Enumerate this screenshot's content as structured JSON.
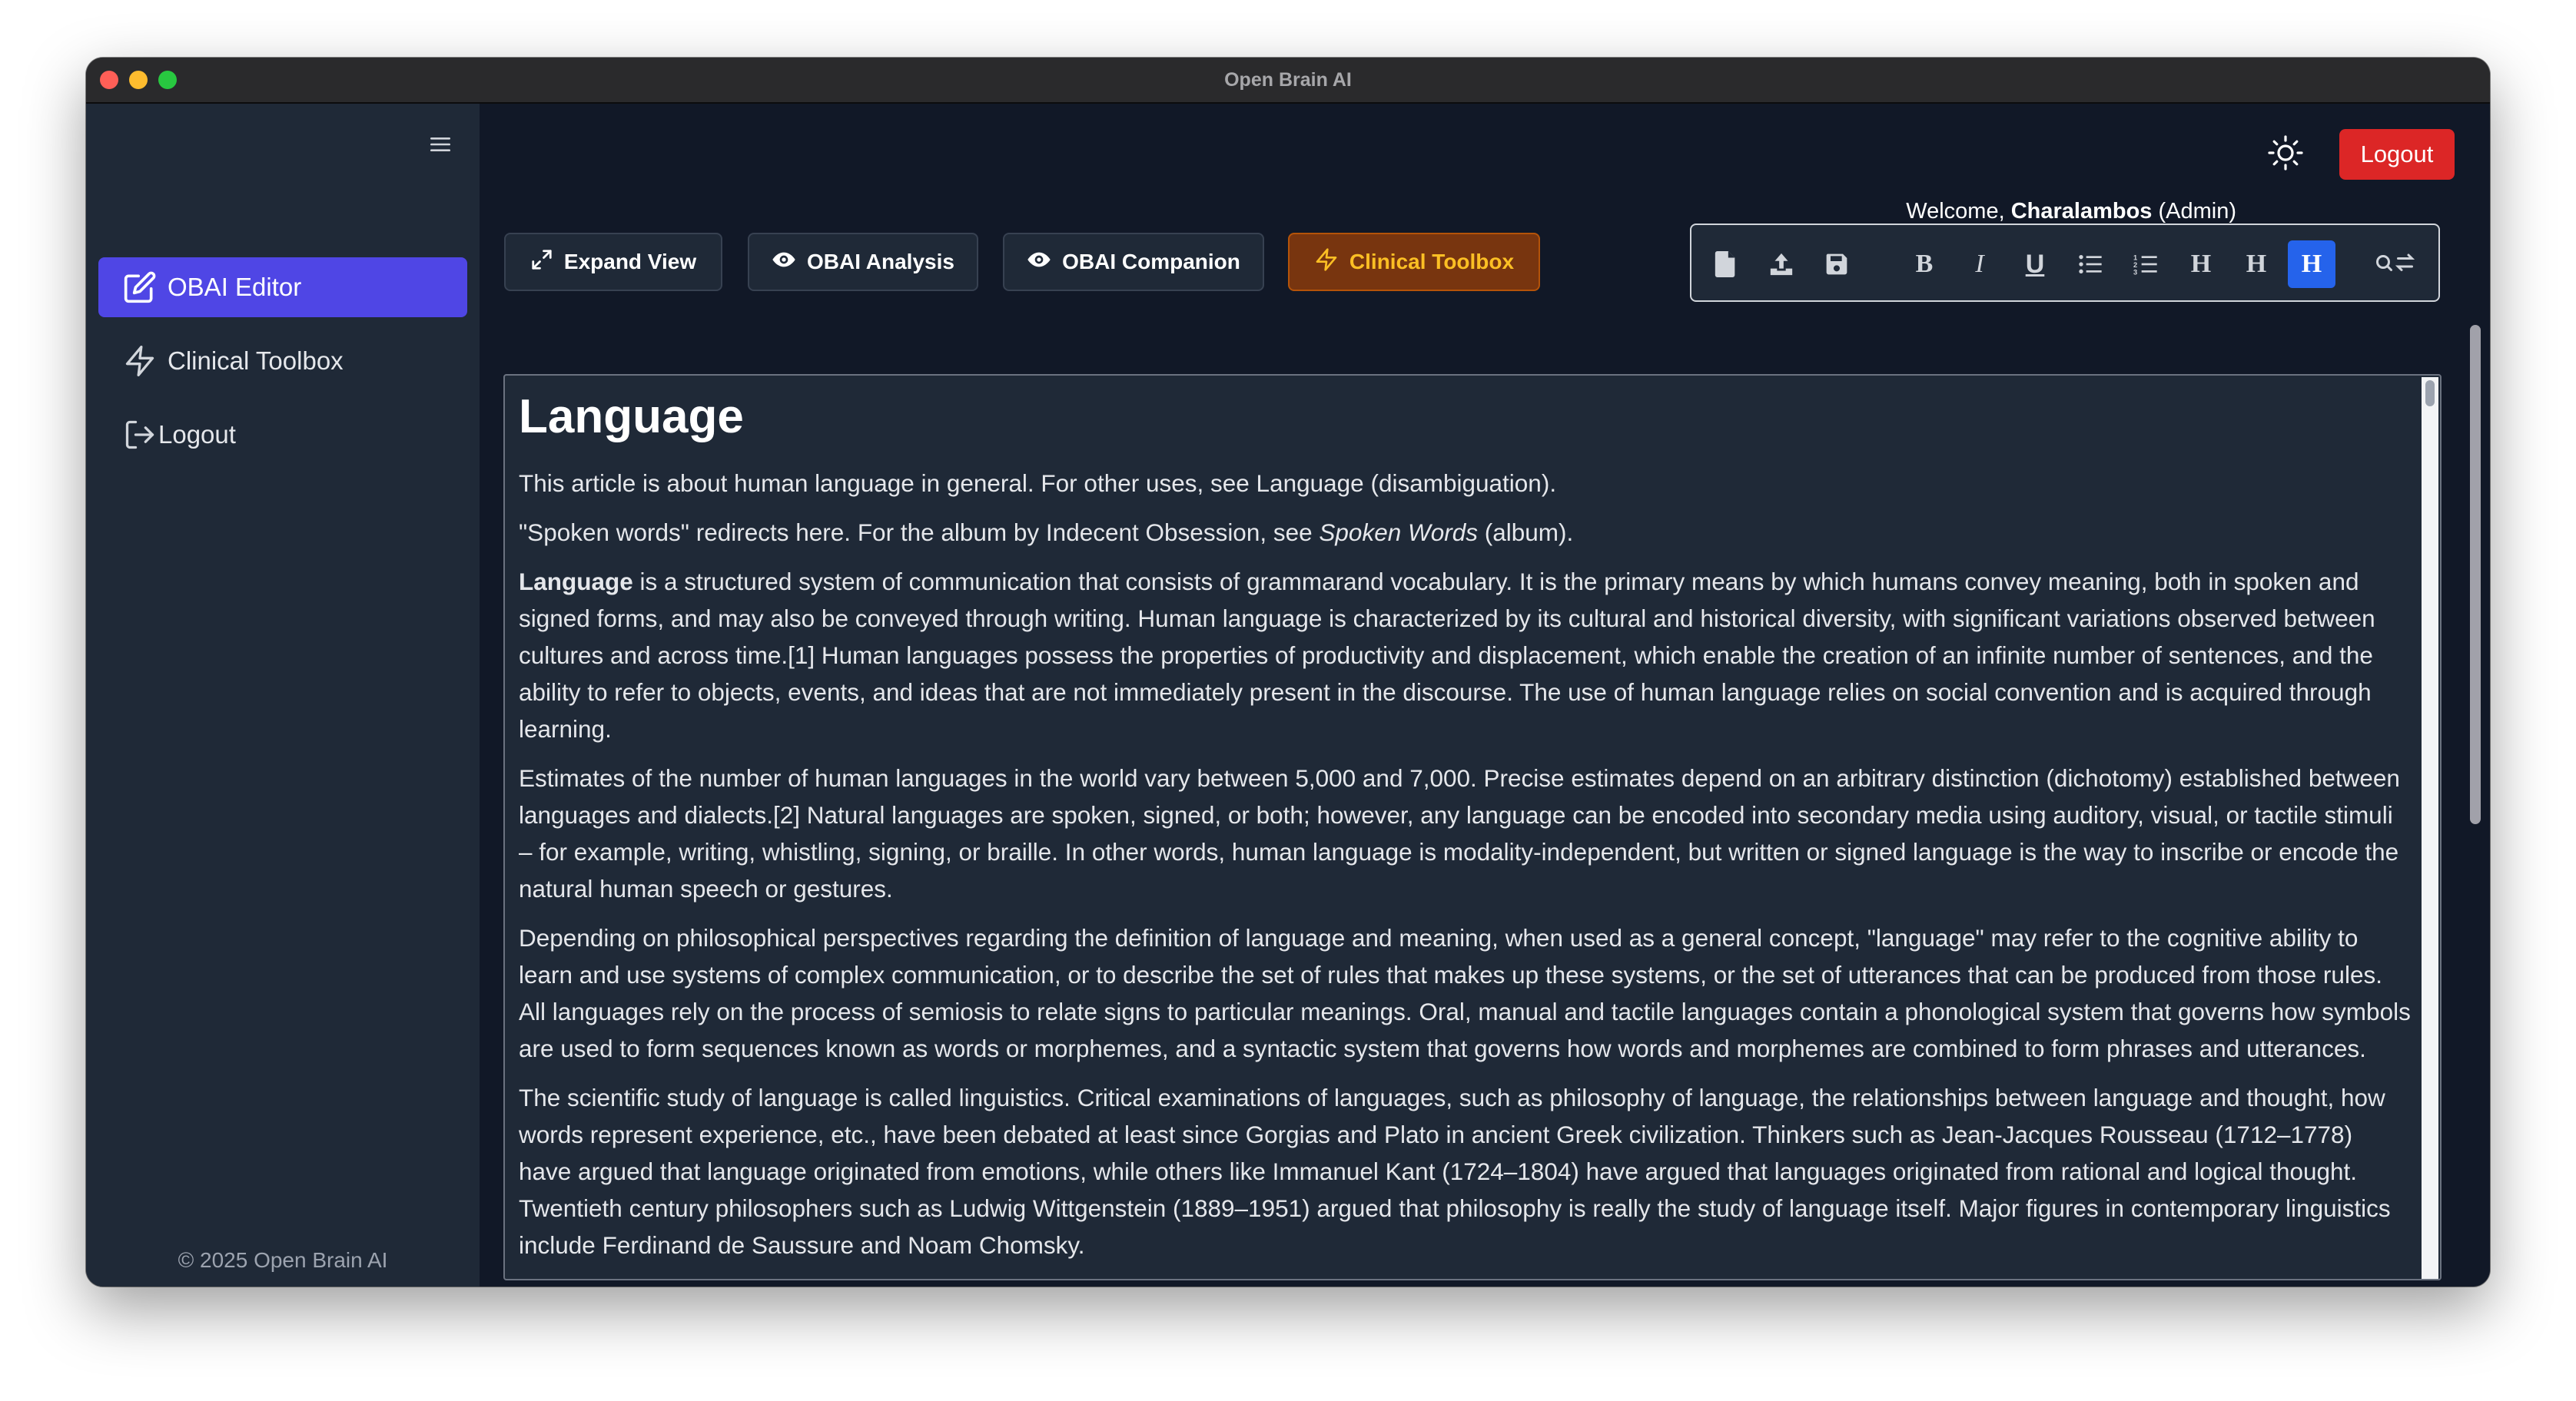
{
  "window": {
    "title": "Open Brain AI"
  },
  "sidebar": {
    "items": [
      {
        "label": "OBAI Editor",
        "icon": "edit-icon",
        "active": true
      },
      {
        "label": "Clinical Toolbox",
        "icon": "lightning-icon",
        "active": false
      },
      {
        "label": "Logout",
        "icon": "logout-icon",
        "active": false
      }
    ],
    "footer": "© 2025 Open Brain AI"
  },
  "header": {
    "welcome_prefix": "Welcome, ",
    "user_name": "Charalambos",
    "user_role": " (Admin)",
    "logout_label": "Logout"
  },
  "toolbar": {
    "buttons": [
      {
        "label": "Expand View",
        "icon": "expand-icon"
      },
      {
        "label": "OBAI Analysis",
        "icon": "eye-icon"
      },
      {
        "label": "OBAI Companion",
        "icon": "eye-icon"
      },
      {
        "label": "Clinical Toolbox",
        "icon": "lightning-icon"
      }
    ],
    "format_buttons": [
      "new-document-icon",
      "upload-icon",
      "save-icon",
      "bold-icon",
      "italic-icon",
      "underline-icon",
      "bullet-list-icon",
      "numbered-list-icon",
      "heading-1-icon",
      "heading-2-icon",
      "heading-3-icon",
      "find-replace-icon"
    ],
    "format_glyphs": {
      "bold": "B",
      "italic": "I",
      "underline": "U",
      "heading": "H"
    }
  },
  "colors": {
    "primary": "#4f46e5",
    "danger": "#dc2626",
    "clinical_bg": "#78350f",
    "clinical_text": "#fbbf24",
    "active_format": "#2563eb"
  },
  "document": {
    "title": "Language",
    "p1": "This article is about human language in general. For other uses, see Language (disambiguation).",
    "p2_before": "\"Spoken words\" redirects here. For the album by Indecent Obsession, see ",
    "p2_italic": "Spoken Words",
    "p2_after": " (album).",
    "p3_bold": "Language",
    "p3_rest": " is a structured system of communication that consists of grammarand vocabulary. It is the primary means by which humans convey meaning, both in spoken and signed forms, and may also be conveyed through writing. Human language is characterized by its cultural and historical diversity, with significant variations observed between cultures and across time.[1] Human languages possess the properties of productivity and displacement, which enable the creation of an infinite number of sentences, and the ability to refer to objects, events, and ideas that are not immediately present in the discourse. The use of human language relies on social convention and is acquired through learning.",
    "p4": "Estimates of the number of human languages in the world vary between 5,000 and 7,000. Precise estimates depend on an arbitrary distinction (dichotomy) established between languages and dialects.[2] Natural languages are spoken, signed, or both; however, any language can be encoded into secondary media using auditory, visual, or tactile stimuli – for example, writing, whistling, signing, or braille. In other words, human language is modality-independent, but written or signed language is the way to inscribe or encode the natural human speech or gestures.",
    "p5": "Depending on philosophical perspectives regarding the definition of language and meaning, when used as a general concept, \"language\" may refer to the cognitive ability to learn and use systems of complex communication, or to describe the set of rules that makes up these systems, or the set of utterances that can be produced from those rules. All languages rely on the process of semiosis to relate signs to particular meanings. Oral, manual and tactile languages contain a phonological system that governs how symbols are used to form sequences known as words or morphemes, and a syntactic system that governs how words and morphemes are combined to form phrases and utterances.",
    "p6": "The scientific study of language is called linguistics. Critical examinations of languages, such as philosophy of language, the relationships between language and thought, how words represent experience, etc., have been debated at least since Gorgias and Plato in ancient Greek civilization. Thinkers such as Jean-Jacques Rousseau (1712–1778) have argued that language originated from emotions, while others like Immanuel Kant (1724–1804) have argued that languages originated from rational and logical thought. Twentieth century philosophers such as Ludwig Wittgenstein (1889–1951) argued that philosophy is really the study of language itself. Major figures in contemporary linguistics include Ferdinand de Saussure and Noam Chomsky."
  }
}
